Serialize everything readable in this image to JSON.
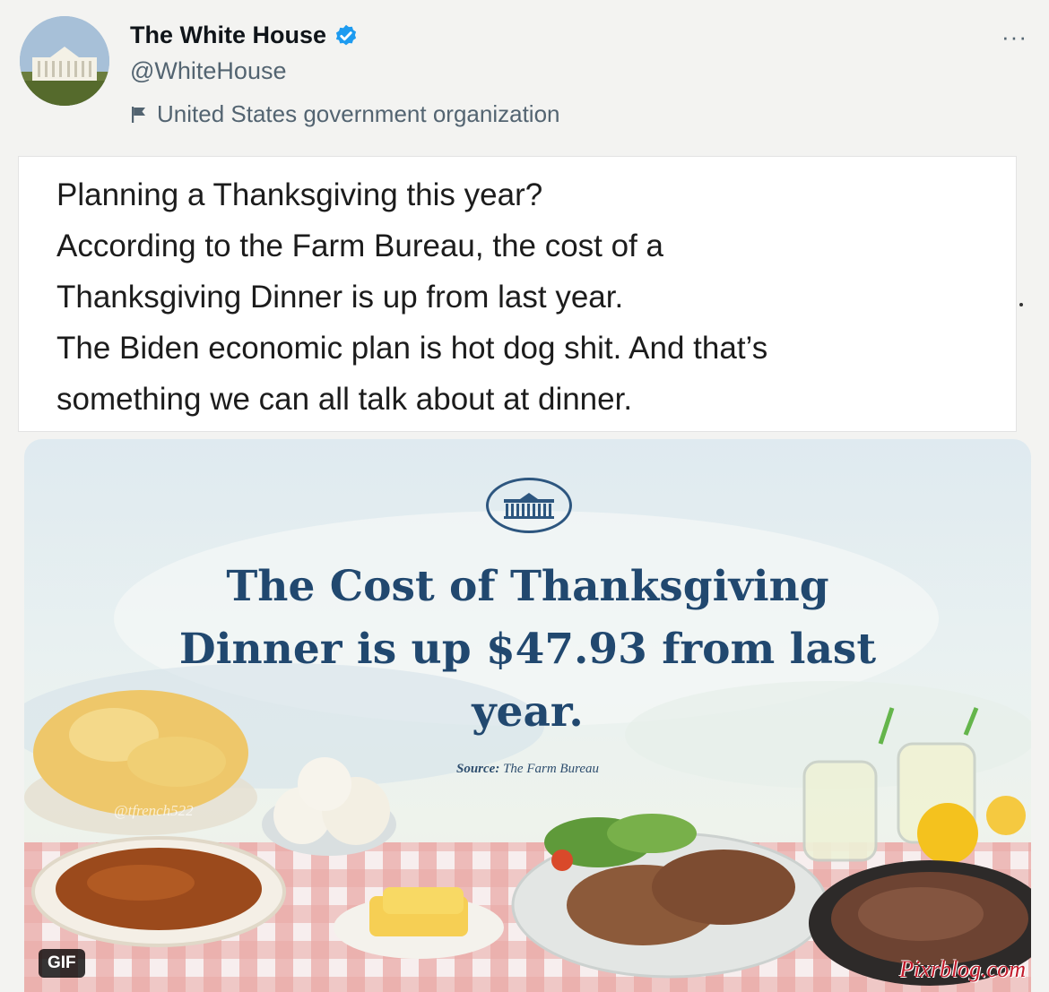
{
  "tweet": {
    "display_name": "The White House",
    "handle": "@WhiteHouse",
    "affiliation": "United States government organization",
    "more_label": "···",
    "body_lines": [
      "Planning a Thanksgiving this year?",
      "According to the Farm Bureau, the cost of a",
      "Thanksgiving Dinner is up from last year.",
      "The Biden economic plan is hot dog shit. And that’s",
      "something we can all talk about at dinner."
    ]
  },
  "media": {
    "headline_lines": [
      "The Cost of Thanksgiving",
      "Dinner is up $47.93 from last",
      "year."
    ],
    "source_label": "Source:",
    "source_value": "The Farm Bureau",
    "gif_badge": "GIF",
    "handle_watermark": "@tfrench522",
    "site_watermark": "Pixrblog.com"
  },
  "colors": {
    "verified_badge": "#1d9bf0",
    "headline": "#21486f",
    "tablecloth_check": "#e08f8f"
  }
}
